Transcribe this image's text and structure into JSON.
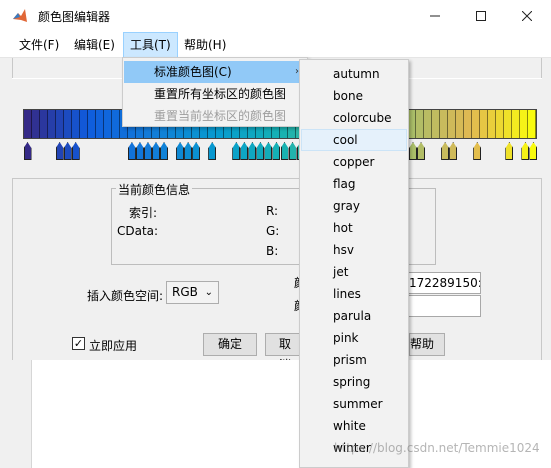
{
  "window": {
    "title": "颜色图编辑器",
    "controls": [
      "minimize",
      "maximize",
      "close"
    ]
  },
  "menubar": {
    "items": [
      "文件(F)",
      "编辑(E)",
      "工具(T)",
      "帮助(H)"
    ],
    "active": "工具(T)"
  },
  "tools_menu": {
    "items": [
      {
        "label": "标准颜色图(C)",
        "state": "highlighted",
        "has_submenu": true
      },
      {
        "label": "重置所有坐标区的颜色图",
        "state": "normal"
      },
      {
        "label": "重置当前坐标区的颜色图",
        "state": "disabled"
      }
    ]
  },
  "colormap_menu": {
    "items": [
      "autumn",
      "bone",
      "colorcube",
      "cool",
      "copper",
      "flag",
      "gray",
      "hot",
      "hsv",
      "jet",
      "lines",
      "parula",
      "pink",
      "prism",
      "spring",
      "summer",
      "white",
      "winter"
    ],
    "highlighted": "cool"
  },
  "color_info": {
    "title": "当前颜色信息",
    "index_label": "索引:",
    "cdata_label": "CData:",
    "r_label": "R:",
    "g_label": "G:",
    "b_label": "B:"
  },
  "colorspace": {
    "label": "插入颜色空间:",
    "value": "RGB"
  },
  "fields": {
    "value_text": "172289150:",
    "partial_label_1": "颜",
    "partial_label_2": "颜"
  },
  "apply_immediately": {
    "label": "立即应用",
    "checked": true
  },
  "buttons": {
    "ok": "确定",
    "cancel_partial": "取消",
    "help_partial": "帮助"
  },
  "watermark": "https://blog.csdn.net/Temmie1024",
  "colors": {
    "menu_highlight": "#91c9f7",
    "submenu_highlight": "#e5f1fb",
    "parula_start": "#352a87",
    "parula_end": "#f9fb0e"
  }
}
